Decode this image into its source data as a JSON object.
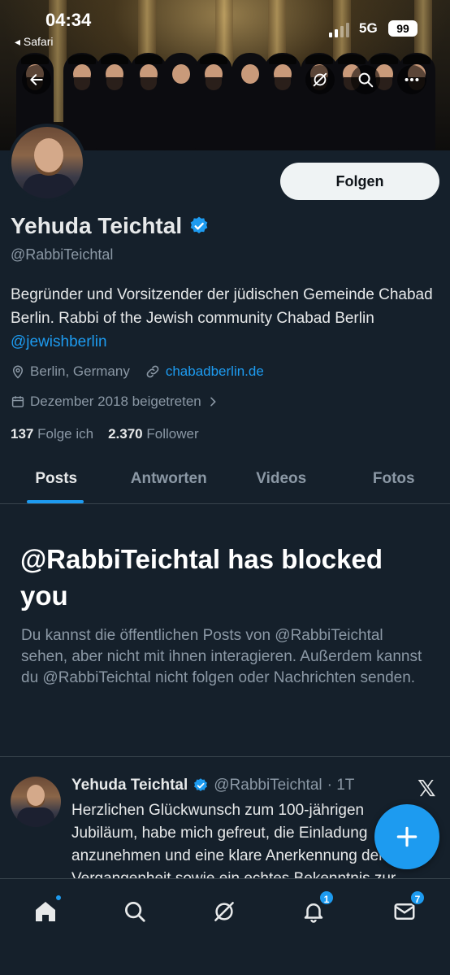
{
  "status_bar": {
    "time": "04:34",
    "back_app": "◂ Safari",
    "network": "5G",
    "battery": "99"
  },
  "profile": {
    "name": "Yehuda Teichtal",
    "handle": "@RabbiTeichtal",
    "follow_label": "Folgen",
    "bio": "Begründer und Vorsitzender der jüdischen Gemeinde Chabad Berlin. Rabbi of the Jewish community Chabad Berlin ",
    "bio_mention": "@jewishberlin",
    "location": "Berlin, Germany",
    "website": "chabadberlin.de",
    "joined": "Dezember 2018 beigetreten",
    "following_count": "137",
    "following_label": "Folge ich",
    "followers_count": "2.370",
    "followers_label": "Follower"
  },
  "tabs": [
    {
      "label": "Posts",
      "active": true
    },
    {
      "label": "Antworten",
      "active": false
    },
    {
      "label": "Videos",
      "active": false
    },
    {
      "label": "Fotos",
      "active": false
    }
  ],
  "blocked": {
    "title": "@RabbiTeichtal has blocked you",
    "text": "Du kannst die öffentlichen Posts von @RabbiTeichtal sehen, aber nicht mit ihnen interagieren. Außerdem kannst du @RabbiTeichtal nicht folgen oder Nachrichten senden."
  },
  "post": {
    "name": "Yehuda Teichtal",
    "handle": "@RabbiTeichtal",
    "time": "· 1T",
    "lines": [
      "Herzlichen Glückwunsch zum 100-jährigen",
      "Jubiläum, habe mich gefreut, die Einladung",
      "anzunehmen und eine klare Anerkennung der",
      "Vergangenheit sowie ein echtes Bekenntnis zur"
    ]
  },
  "nav": {
    "notifications_badge": "1",
    "messages_badge": "7"
  },
  "colors": {
    "accent": "#1d9bf0",
    "background": "#15202b",
    "secondary_text": "#8b98a5"
  }
}
